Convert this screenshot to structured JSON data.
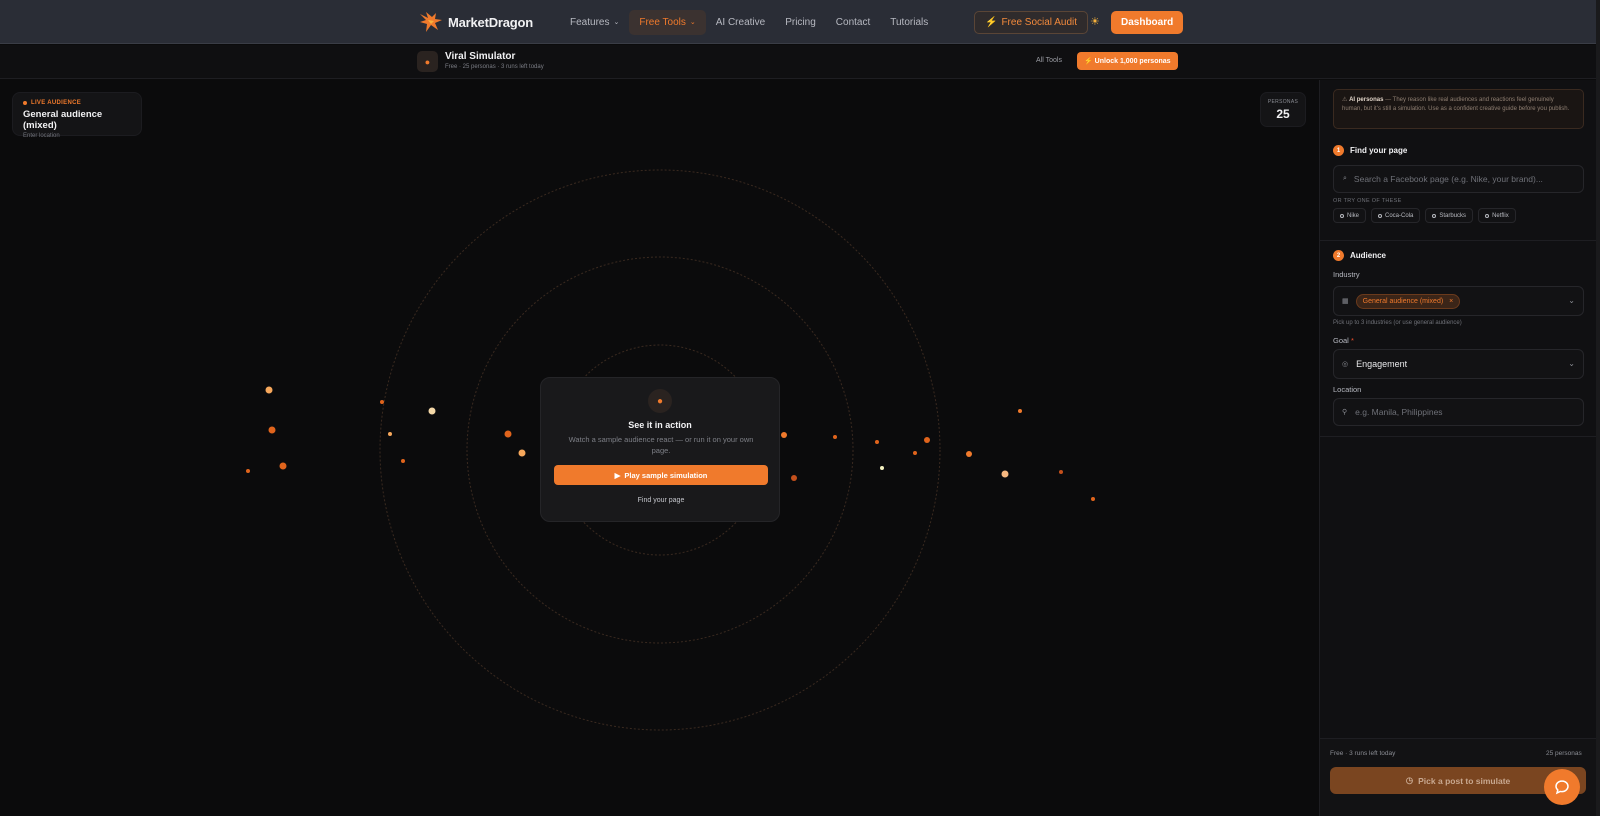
{
  "nav": {
    "brand": "MarketDragon",
    "links": [
      {
        "label": "Features",
        "dropdown": true,
        "active": false
      },
      {
        "label": "Free Tools",
        "dropdown": true,
        "active": true
      },
      {
        "label": "AI Creative",
        "dropdown": false,
        "active": false
      },
      {
        "label": "Pricing",
        "dropdown": false,
        "active": false
      },
      {
        "label": "Contact",
        "dropdown": false,
        "active": false
      },
      {
        "label": "Tutorials",
        "dropdown": false,
        "active": false
      }
    ],
    "audit_label": "Free Social Audit",
    "dashboard_label": "Dashboard"
  },
  "subheader": {
    "title": "Viral Simulator",
    "subtitle": "Free · 25 personas · 3 runs left today",
    "all_tools": "All Tools",
    "unlock_label": "Unlock 1,000 personas"
  },
  "canvas": {
    "live_label": "LIVE AUDIENCE",
    "live_title": "General audience (mixed)",
    "live_sub": "Enter location",
    "personas_label": "PERSONAS",
    "personas_value": "25",
    "center": {
      "title": "See it in action",
      "text": "Watch a sample audience react — or run it on your own page.",
      "play_label": "Play sample simulation",
      "find_label": "Find your page"
    }
  },
  "panel": {
    "info_bold": "AI personas",
    "info_text": "— They reason like real audiences and reactions feel genuinely human, but it's still a simulation. Use as a confident creative guide before you publish.",
    "step1": {
      "num": "1",
      "title": "Find your page"
    },
    "search_placeholder": "Search a Facebook page (e.g. Nike, your brand)...",
    "try_label": "OR TRY ONE OF THESE",
    "suggestions": [
      "Nike",
      "Coca-Cola",
      "Starbucks",
      "Netflix"
    ],
    "step2": {
      "num": "2",
      "title": "Audience"
    },
    "industry_label": "Industry",
    "industry_tag": "General audience (mixed)",
    "industry_hint": "Pick up to 3 industries (or use general audience)",
    "goal_label": "Goal",
    "goal_required": "*",
    "goal_value": "Engagement",
    "location_label": "Location",
    "location_placeholder": "e.g. Manila, Philippines",
    "runs_left": "Free · 3 runs left today",
    "runs_right": "25 personas",
    "simulate_label": "Pick a post to simulate"
  },
  "colors": {
    "accent": "#f07a2c",
    "background": "#0b0b0c",
    "nav_bg": "#2a2d36"
  }
}
